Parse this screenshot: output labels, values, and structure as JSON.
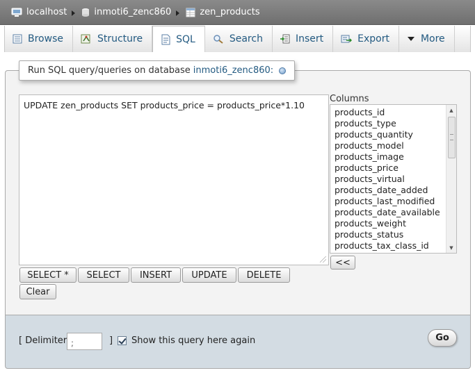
{
  "breadcrumb": {
    "items": [
      {
        "label": "localhost",
        "icon": "server-icon"
      },
      {
        "label": "inmoti6_zenc860",
        "icon": "database-icon"
      },
      {
        "label": "zen_products",
        "icon": "table-icon"
      }
    ]
  },
  "tabs": [
    {
      "label": "Browse",
      "icon": "browse-icon",
      "active": false
    },
    {
      "label": "Structure",
      "icon": "structure-icon",
      "active": false
    },
    {
      "label": "SQL",
      "icon": "sql-icon",
      "active": true
    },
    {
      "label": "Search",
      "icon": "search-icon",
      "active": false
    },
    {
      "label": "Insert",
      "icon": "insert-icon",
      "active": false
    },
    {
      "label": "Export",
      "icon": "export-icon",
      "active": false
    },
    {
      "label": "More",
      "icon": "chevron-down-icon",
      "active": false
    }
  ],
  "query_panel": {
    "legend_prefix": "Run SQL query/queries on database",
    "database": "inmoti6_zenc860:",
    "query_text": "UPDATE zen_products SET products_price = products_price*1.10",
    "columns_label": "Columns",
    "columns": [
      "products_id",
      "products_type",
      "products_quantity",
      "products_model",
      "products_image",
      "products_price",
      "products_virtual",
      "products_date_added",
      "products_last_modified",
      "products_date_available",
      "products_weight",
      "products_status",
      "products_tax_class_id"
    ],
    "insert_column_button": "<<",
    "buttons": {
      "select_star": "SELECT *",
      "select": "SELECT",
      "insert": "INSERT",
      "update": "UPDATE",
      "delete": "DELETE",
      "clear": "Clear"
    }
  },
  "footer": {
    "delimiter_open": "[ Delimiter",
    "delimiter_value": ";",
    "delimiter_close": "]",
    "show_query_label": "Show this query here again",
    "show_query_checked": true,
    "go_label": "Go"
  },
  "colors": {
    "link": "#235a81",
    "breadcrumb_bg": "#7d7d7d",
    "footer_bg": "#d3dce3"
  }
}
